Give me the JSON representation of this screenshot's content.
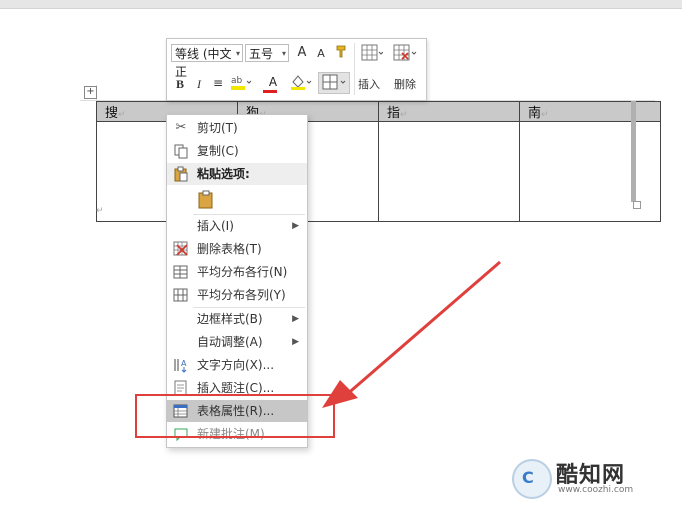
{
  "mini_toolbar": {
    "font_name": "等线 (中文正",
    "font_size": "五号",
    "grow_font": "A",
    "shrink_font": "A",
    "bold": "B",
    "italic": "I",
    "font_color": "A",
    "insert_label": "插入",
    "delete_label": "删除"
  },
  "table": {
    "headers": [
      "搜",
      "狗",
      "指",
      "南"
    ]
  },
  "context_menu": {
    "items": [
      {
        "label": "剪切(T)",
        "icon": "scissors-icon"
      },
      {
        "label": "复制(C)",
        "icon": "copy-icon"
      },
      {
        "label": "粘贴选项:",
        "icon": "clipboard-icon"
      },
      {
        "label": "",
        "icon": "paste-keep-format-icon"
      },
      {
        "label": "插入(I)",
        "icon": ""
      },
      {
        "label": "删除表格(T)",
        "icon": "delete-table-icon"
      },
      {
        "label": "平均分布各行(N)",
        "icon": "distribute-rows-icon"
      },
      {
        "label": "平均分布各列(Y)",
        "icon": "distribute-columns-icon"
      },
      {
        "label": "边框样式(B)",
        "icon": ""
      },
      {
        "label": "自动调整(A)",
        "icon": ""
      },
      {
        "label": "文字方向(X)...",
        "icon": "text-direction-icon"
      },
      {
        "label": "插入题注(C)...",
        "icon": "insert-caption-icon"
      },
      {
        "label": "表格属性(R)...",
        "icon": "table-properties-icon"
      },
      {
        "label": "新建批注(M)",
        "icon": "new-comment-icon"
      }
    ]
  },
  "watermark": {
    "logo_text": "C",
    "name": "酷知网",
    "url": "www.coozhi.com"
  },
  "colors": {
    "highlight_box": "#e0403c",
    "header_fill": "#c9c9c9"
  }
}
